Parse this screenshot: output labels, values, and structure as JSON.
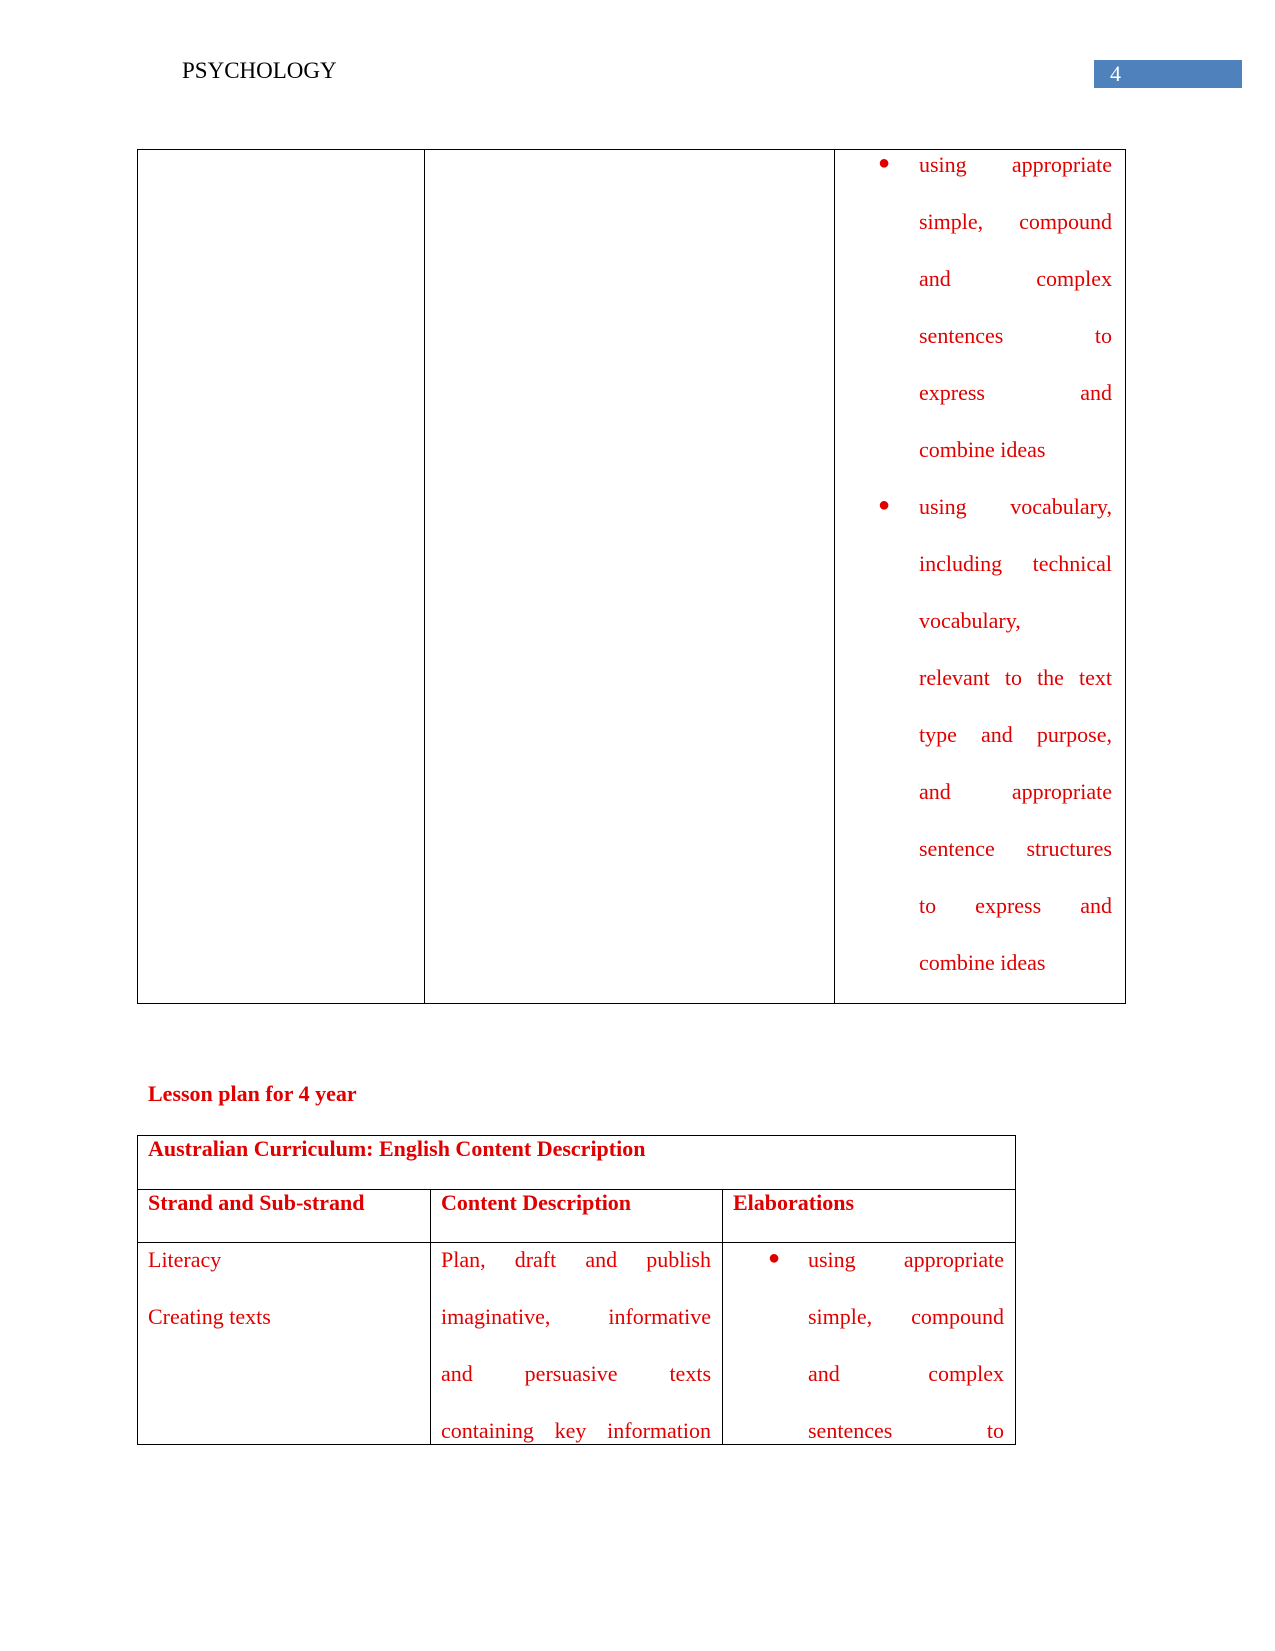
{
  "header": {
    "title": "PSYCHOLOGY",
    "page_number": "4"
  },
  "table1": {
    "elaborations": [
      {
        "lines": [
          "using appropriate",
          "simple, compound",
          "and complex",
          "sentences to",
          "express and",
          "combine ideas"
        ]
      },
      {
        "lines": [
          "using vocabulary,",
          "including technical",
          "vocabulary,",
          "relevant to the text",
          "type and purpose,",
          "and appropriate",
          "sentence structures",
          "to express and",
          "combine ideas"
        ]
      }
    ]
  },
  "lesson_title": "Lesson plan for 4 year",
  "table2": {
    "title": "Australian Curriculum: English Content Description",
    "headers": [
      "Strand and Sub-strand",
      "Content Description",
      "Elaborations"
    ],
    "strand": [
      "Literacy",
      "Creating texts"
    ],
    "content_lines": [
      "Plan, draft and publish",
      "imaginative, informative",
      "and persuasive texts",
      "containing key information"
    ],
    "elaboration_lines": [
      "using appropriate",
      "simple, compound",
      "and complex",
      "sentences to"
    ]
  },
  "colors": {
    "text": "#e00000",
    "header_badge": "#4f81bd"
  }
}
